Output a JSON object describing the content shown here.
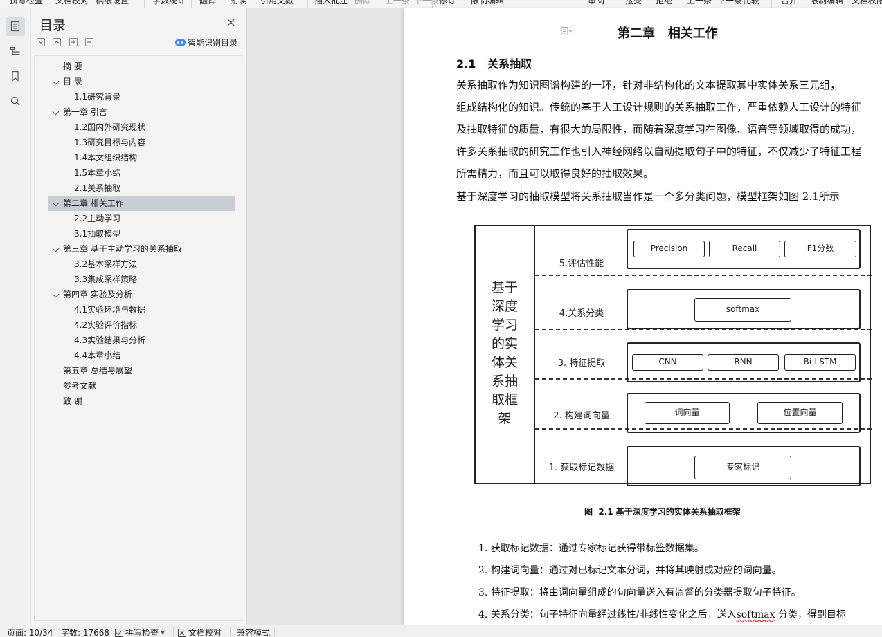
{
  "toolbar": {
    "items": [
      "拼写检查",
      "文档校对",
      "稿纸设置",
      "字数统计",
      "翻译",
      "朗读",
      "引用文献",
      "插入批注",
      "删除",
      "上一条",
      "下一条",
      "修订",
      "限制编辑",
      "审阅",
      "接受",
      "拒绝",
      "上一条",
      "下一条",
      "比较",
      "合并",
      "限制编辑",
      "文档权限"
    ]
  },
  "rail": {
    "icons": [
      "outline-icon",
      "navigation-icon",
      "bookmark-icon",
      "search-icon"
    ]
  },
  "toc": {
    "title": "目录",
    "smart_label": "智能识别目录",
    "items": [
      {
        "label": "摘 要",
        "level": 0,
        "expand": false
      },
      {
        "label": "目 录",
        "level": 0,
        "expand": true
      },
      {
        "label": "1.1研究背景",
        "level": 1,
        "expand": false
      },
      {
        "label": "第一章 引言",
        "level": 0,
        "expand": true
      },
      {
        "label": "1.2国内外研究现状",
        "level": 1,
        "expand": false
      },
      {
        "label": "1.3研究目标与内容",
        "level": 1,
        "expand": false
      },
      {
        "label": "1.4本文组织结构",
        "level": 1,
        "expand": false
      },
      {
        "label": "1.5本章小结",
        "level": 1,
        "expand": false
      },
      {
        "label": "2.1关系抽取",
        "level": 1,
        "expand": false
      },
      {
        "label": "第二章 相关工作",
        "level": 0,
        "expand": true,
        "selected": true
      },
      {
        "label": "2.2主动学习",
        "level": 1,
        "expand": false
      },
      {
        "label": "3.1抽取模型",
        "level": 1,
        "expand": false
      },
      {
        "label": "第三章 基于主动学习的关系抽取",
        "level": 0,
        "expand": true
      },
      {
        "label": "3.2基本采样方法",
        "level": 1,
        "expand": false
      },
      {
        "label": "3.3集成采样策略",
        "level": 1,
        "expand": false
      },
      {
        "label": "第四章 实验及分析",
        "level": 0,
        "expand": true
      },
      {
        "label": "4.1实验环境与数据",
        "level": 1,
        "expand": false
      },
      {
        "label": "4.2实验评价指标",
        "level": 1,
        "expand": false
      },
      {
        "label": "4.3实验结果与分析",
        "level": 1,
        "expand": false
      },
      {
        "label": "4.4本章小结",
        "level": 1,
        "expand": false
      },
      {
        "label": "第五章 总结与展望",
        "level": 0,
        "expand": false
      },
      {
        "label": "参考文献",
        "level": 0,
        "expand": false
      },
      {
        "label": "致 谢",
        "level": 0,
        "expand": false
      }
    ]
  },
  "doc": {
    "chapter_title": "第二章   相关工作",
    "section_title": "2.1   关系抽取",
    "para1": [
      "      关系抽取作为知识图谱构建的一环，针对非结构化的文本提取其中实体关系三元组，",
      "组成结构化的知识。传统的基于人工设计规则的关系抽取工作，严重依赖人工设计的特征",
      "及抽取特征的质量，有很大的局限性，而随着深度学习在图像、语音等领域取得的成功，",
      "许多关系抽取的研究工作也引入神经网络以自动提取句子中的特征，不仅减少了特征工程",
      "所需精力，而且可以取得良好的抽取效果。"
    ],
    "para2": "      基于深度学习的抽取模型将关系抽取当作是一个多分类问题，模型框架如图  2.1所示",
    "figure": {
      "left_text": "基于深度学习的实体关系抽取框架",
      "rows": [
        {
          "label": "5.评估性能",
          "boxes": [
            "Precision",
            "Recall",
            "F1分数"
          ]
        },
        {
          "label": "4.关系分类",
          "boxes": [
            "softmax"
          ]
        },
        {
          "label": "3. 特征提取",
          "boxes": [
            "CNN",
            "RNN",
            "Bi-LSTM"
          ]
        },
        {
          "label": "2. 构建词向量",
          "boxes": [
            "词向量",
            "位置向量"
          ]
        },
        {
          "label": "1. 获取标记数据",
          "boxes": [
            "专家标记"
          ]
        }
      ],
      "caption": "图  2.1 基于深度学习的实体关系抽取框架"
    },
    "list": [
      {
        "prefix": "1.  ",
        "text": "获取标记数据：通过专家标记获得带标签数据集。"
      },
      {
        "prefix": "2.  ",
        "text": "构建词向量：通过对已标记文本分词，并将其映射成对应的词向量。"
      },
      {
        "prefix": "3.  ",
        "text": "特征提取：将由词向量组成的句向量送入有监督的分类器提取句子特征。"
      },
      {
        "prefix": "4.  ",
        "text_before": "关系分类：句子特征向量经过线性/非线性变化之后，送入",
        "squiggle": "softmax",
        "text_after": " 分类，得到目标"
      }
    ]
  },
  "status": {
    "page": "页面: 10/34",
    "words": "字数: 17668",
    "spell": "拼写检查",
    "proof": "文档校对",
    "compat": "兼容模式"
  }
}
